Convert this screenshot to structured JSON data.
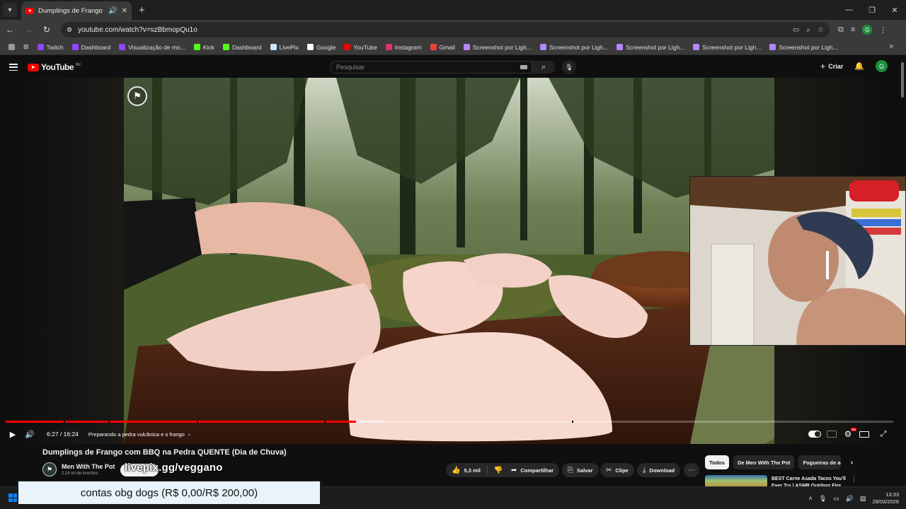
{
  "browser": {
    "tab": {
      "title": "Dumplings de Frango com BBQ na Pedra QUENTE (Dia de Chuva)"
    },
    "url": "youtube.com/watch?v=szBbmopQu1o",
    "bookmarks": [
      {
        "label": "Twitch",
        "icon": "twitch-icon",
        "color": "#9146ff"
      },
      {
        "label": "Dashboard",
        "icon": "twitch-icon",
        "color": "#9146ff"
      },
      {
        "label": "Visualização de mo...",
        "icon": "twitch-icon",
        "color": "#9146ff"
      },
      {
        "label": "Kick",
        "icon": "kick-icon",
        "color": "#53fc18"
      },
      {
        "label": "Dashboard",
        "icon": "kick-icon",
        "color": "#53fc18"
      },
      {
        "label": "LivePix",
        "icon": "livepix-icon",
        "color": "#c8e6ff"
      },
      {
        "label": "Google",
        "icon": "google-icon",
        "color": "#ffffff"
      },
      {
        "label": "YouTube",
        "icon": "youtube-icon",
        "color": "#ff0000"
      },
      {
        "label": "Instagram",
        "icon": "instagram-icon",
        "color": "#e1306c"
      },
      {
        "label": "Gmail",
        "icon": "gmail-icon",
        "color": "#ea4335"
      },
      {
        "label": "Screenshot por Ligh...",
        "icon": "lightshot-icon",
        "color": "#b388ff"
      },
      {
        "label": "Screenshot por Ligh...",
        "icon": "lightshot-icon",
        "color": "#b388ff"
      },
      {
        "label": "Screenshot por Ligh...",
        "icon": "lightshot-icon",
        "color": "#b388ff"
      },
      {
        "label": "Screenshot por Ligh...",
        "icon": "lightshot-icon",
        "color": "#b388ff"
      },
      {
        "label": "Screenshot por Ligh...",
        "icon": "lightshot-icon",
        "color": "#b388ff"
      }
    ],
    "profile_initial": "G"
  },
  "youtube": {
    "search_placeholder": "Pesquisar",
    "create_label": "Criar",
    "avatar_initial": "G",
    "logo_text": "YouTube",
    "logo_region": "BR"
  },
  "player": {
    "progress_fraction": 0.3948,
    "buffer_fraction": 0.425,
    "time_current": "6:27",
    "time_sep": " / ",
    "time_total": "16:24",
    "chapter": "Preparando a pedra vulcânica e o frango",
    "accent_color": "#ff0000"
  },
  "video": {
    "title": "Dumplings de Frango com BBQ na Pedra QUENTE (Dia de Chuva)",
    "channel": "Men With The Pot",
    "subscribers": "2,14 mi de inscritos",
    "likes": "5,3 mil",
    "share": "Compartilhar",
    "save": "Salvar",
    "clip": "Clipe",
    "download": "Download"
  },
  "sidebar": {
    "chips": [
      "Todos",
      "De Men With The Pot",
      "Fogueiras de ac"
    ],
    "recommendation": {
      "title": "BEST Carne Asada Tacos You'll Ever Try | ASMR Outdoor Fire"
    }
  },
  "stream_overlay": {
    "handle": "livepix.gg/veggano",
    "donation_text": "contas obg dogs (R$ 0,00/R$ 200,00)"
  },
  "taskbar": {
    "time": "13:33",
    "date": "29/03/2026"
  }
}
